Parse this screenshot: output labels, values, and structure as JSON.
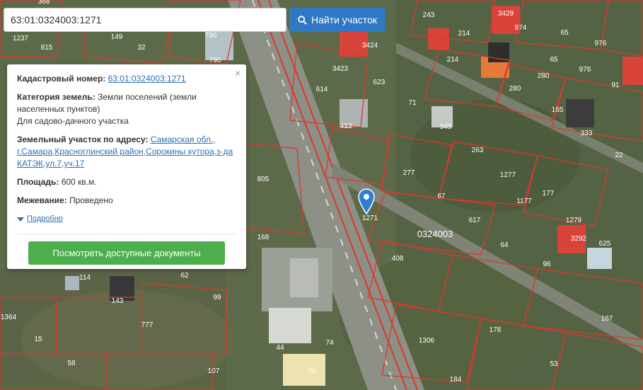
{
  "search": {
    "value": "63:01:0324003:1271",
    "button_label": "Найти участок"
  },
  "popup": {
    "cadastral_label": "Кадастровый номер:",
    "cadastral_number": "63:01:0324003:1271",
    "category_label": "Категория земель:",
    "category_value": "Земли поселений (земли населенных пунктов)",
    "category_use": "Для садово-дачного участка",
    "address_label": "Земельный участок по адресу:",
    "address_value": "Самарская обл., г.Самара,Красноглинский район,Сорокины хутора,з-да КАТЭК,ул.7,уч.17",
    "area_label": "Площадь:",
    "area_value": "600 кв.м.",
    "survey_label": "Межевание:",
    "survey_value": "Проведено",
    "more_label": "Подробно",
    "docs_button": "Посмотреть доступные документы",
    "close_symbol": "×"
  },
  "map": {
    "block_label": "0324003",
    "parcel_labels": [
      "368",
      "149",
      "815",
      "1237",
      "790",
      "790",
      "3424",
      "3423",
      "614",
      "623",
      "413",
      "243",
      "3429",
      "974",
      "214",
      "214",
      "65",
      "976",
      "65",
      "976",
      "91",
      "280",
      "280",
      "165",
      "333",
      "71",
      "343",
      "263",
      "22",
      "277",
      "1277",
      "177",
      "1177",
      "67",
      "617",
      "1279",
      "1271",
      "408",
      "64",
      "625",
      "805",
      "168",
      "114",
      "62",
      "143",
      "777",
      "99",
      "1364",
      "15",
      "44",
      "74",
      "58",
      "107",
      "70",
      "1306",
      "178",
      "167",
      "184",
      "53",
      "96",
      "3292",
      "32"
    ],
    "colors": {
      "parcel_line": "#e0362c",
      "road": "#8a8f86",
      "roof_red": "#d9443a"
    }
  }
}
